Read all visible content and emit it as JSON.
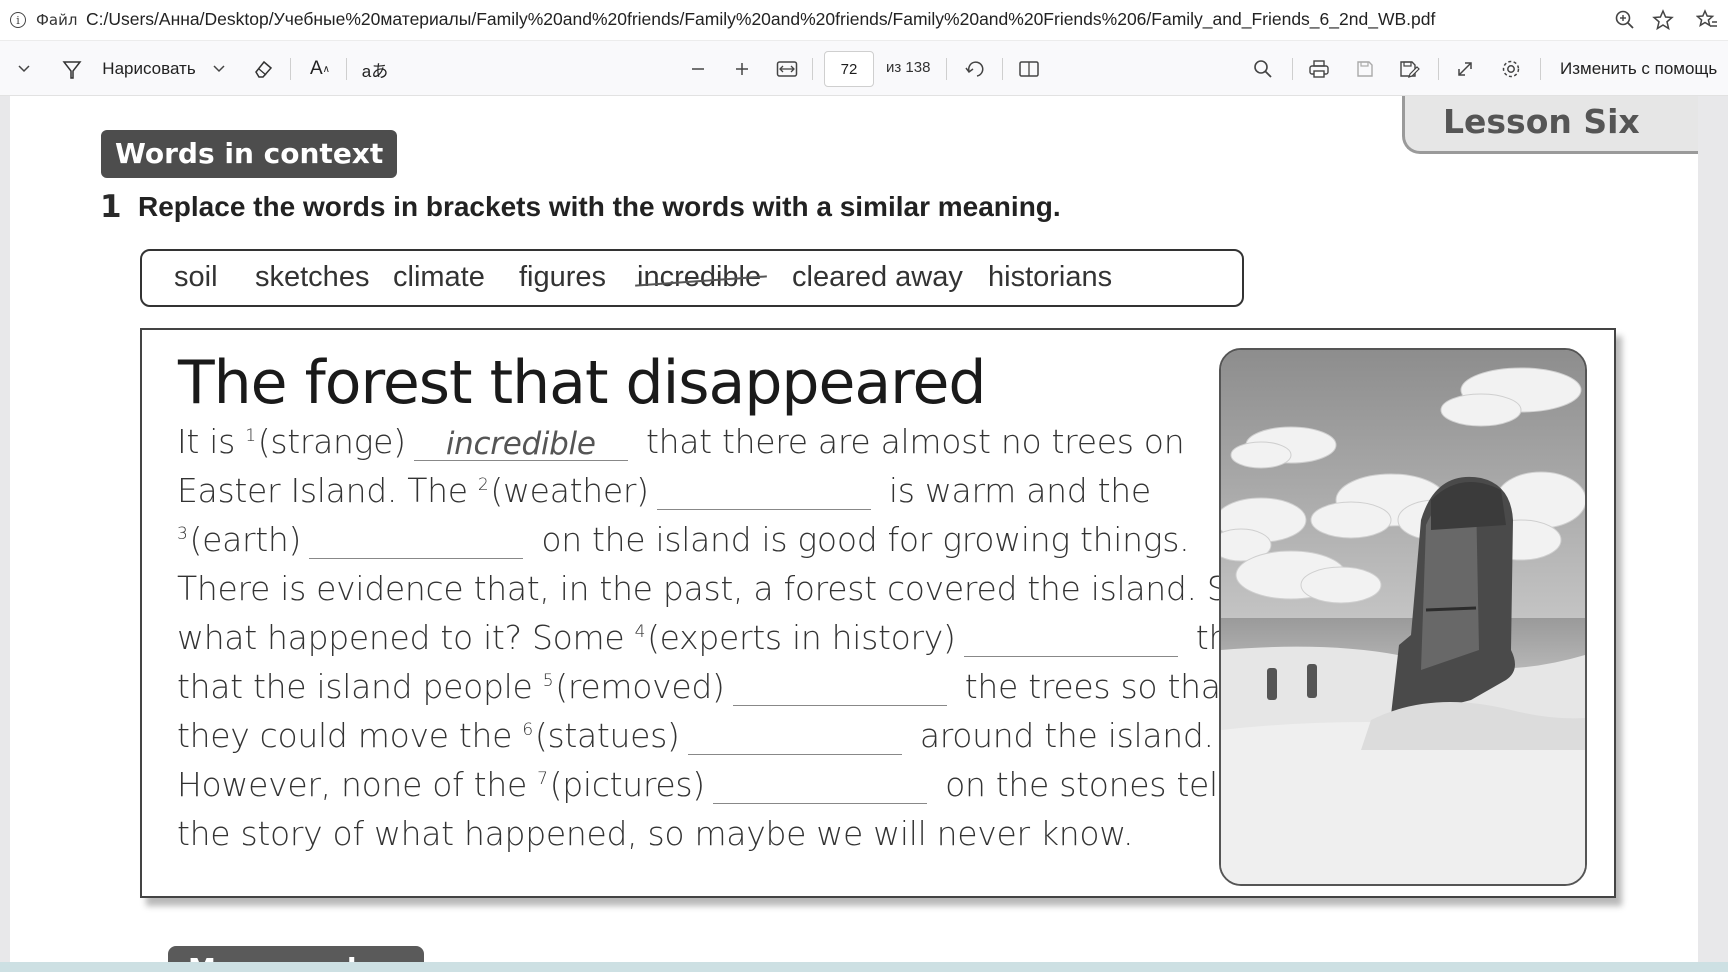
{
  "addressbar": {
    "file_label": "Файл",
    "url": "C:/Users/Анна/Desktop/Учебные%20материалы/Family%20and%20friends/Family%20and%20friends/Family%20and%20Friends%206/Family_and_Friends_6_2nd_WB.pdf"
  },
  "toolbar": {
    "draw_label": "Нарисовать",
    "text_label": "A",
    "translate_glyph": "aあ",
    "page_current": "72",
    "page_total": "из 138",
    "edit_label": "Изменить с помощь"
  },
  "page": {
    "lesson_tab": "Lesson Six",
    "section_badge": "Words in context",
    "exercise_number": "1",
    "exercise_instruction": "Replace the words in brackets with the words with a similar meaning.",
    "word_bank": [
      "soil",
      "sketches",
      "climate",
      "figures",
      "incredible",
      "cleared away",
      "historians"
    ],
    "struck_word": "incredible",
    "story": {
      "title": "The forest that disappeared",
      "lines": [
        {
          "pre": "It is ",
          "num": "1",
          "hint": "(strange)",
          "answer": "incredible",
          "post": " that there are almost no trees on"
        },
        {
          "pre": "Easter Island. The ",
          "num": "2",
          "hint": "(weather)",
          "answer": "",
          "post": " is warm and the"
        },
        {
          "pre": "",
          "num": "3",
          "hint": "(earth)",
          "answer": "",
          "post": " on the island is good for growing things."
        },
        {
          "text": "There is evidence that, in the past, a forest covered the island. So,"
        },
        {
          "pre": "what happened to it? Some ",
          "num": "4",
          "hint": "(experts in history)",
          "answer": "",
          "post": " think"
        },
        {
          "pre": "that the island people ",
          "num": "5",
          "hint": "(removed)",
          "answer": "",
          "post": " the trees so that"
        },
        {
          "pre": "they could move the ",
          "num": "6",
          "hint": "(statues)",
          "answer": "",
          "post": " around the island."
        },
        {
          "pre": "However, none of the ",
          "num": "7",
          "hint": "(pictures)",
          "answer": "",
          "post": " on the stones tell"
        },
        {
          "text": "the story of what happened, so maybe we will never know."
        }
      ]
    },
    "next_section_partial": "More words"
  }
}
